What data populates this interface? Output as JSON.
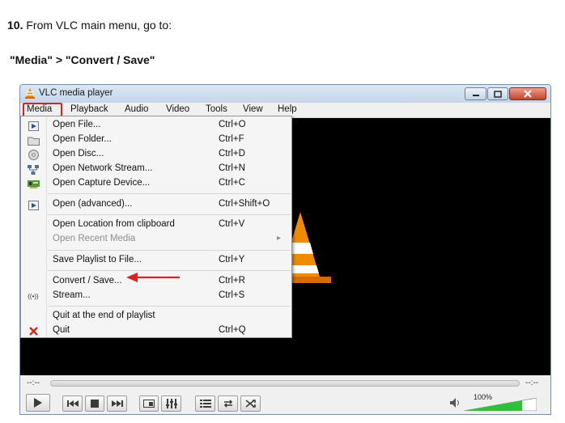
{
  "instructions": {
    "step_number": "10.",
    "step_text": "From VLC main menu, go to:",
    "path": "\"Media\" > \"Convert / Save\""
  },
  "window": {
    "title": "VLC media player"
  },
  "menubar": {
    "items": [
      "Media",
      "Playback",
      "Audio",
      "Video",
      "Tools",
      "View",
      "Help"
    ]
  },
  "media_menu": {
    "items": [
      {
        "label": "Open File...",
        "shortcut": "Ctrl+O",
        "icon": "play-file-icon"
      },
      {
        "label": "Open Folder...",
        "shortcut": "Ctrl+F",
        "icon": "folder-icon"
      },
      {
        "label": "Open Disc...",
        "shortcut": "Ctrl+D",
        "icon": "disc-icon"
      },
      {
        "label": "Open Network Stream...",
        "shortcut": "Ctrl+N",
        "icon": "network-icon"
      },
      {
        "label": "Open Capture Device...",
        "shortcut": "Ctrl+C",
        "icon": "capture-card-icon"
      },
      {
        "label": "Open (advanced)...",
        "shortcut": "Ctrl+Shift+O",
        "icon": "play-file-icon"
      },
      {
        "label": "Open Location from clipboard",
        "shortcut": "Ctrl+V"
      },
      {
        "label": "Open Recent Media",
        "submenu": "▸",
        "disabled": true
      },
      {
        "label": "Save Playlist to File...",
        "shortcut": "Ctrl+Y"
      },
      {
        "label": "Convert / Save...",
        "shortcut": "Ctrl+R"
      },
      {
        "label": "Stream...",
        "shortcut": "Ctrl+S",
        "icon": "stream-icon",
        "icon_text": "((•))"
      },
      {
        "label": "Quit at the end of playlist"
      },
      {
        "label": "Quit",
        "shortcut": "Ctrl+Q",
        "icon": "close-x-icon"
      }
    ]
  },
  "controls": {
    "time_elapsed": "--:--",
    "time_total": "--:--",
    "volume": "100%"
  },
  "colors": {
    "highlight_red": "#e0201c",
    "cone_orange": "#f08a00"
  }
}
